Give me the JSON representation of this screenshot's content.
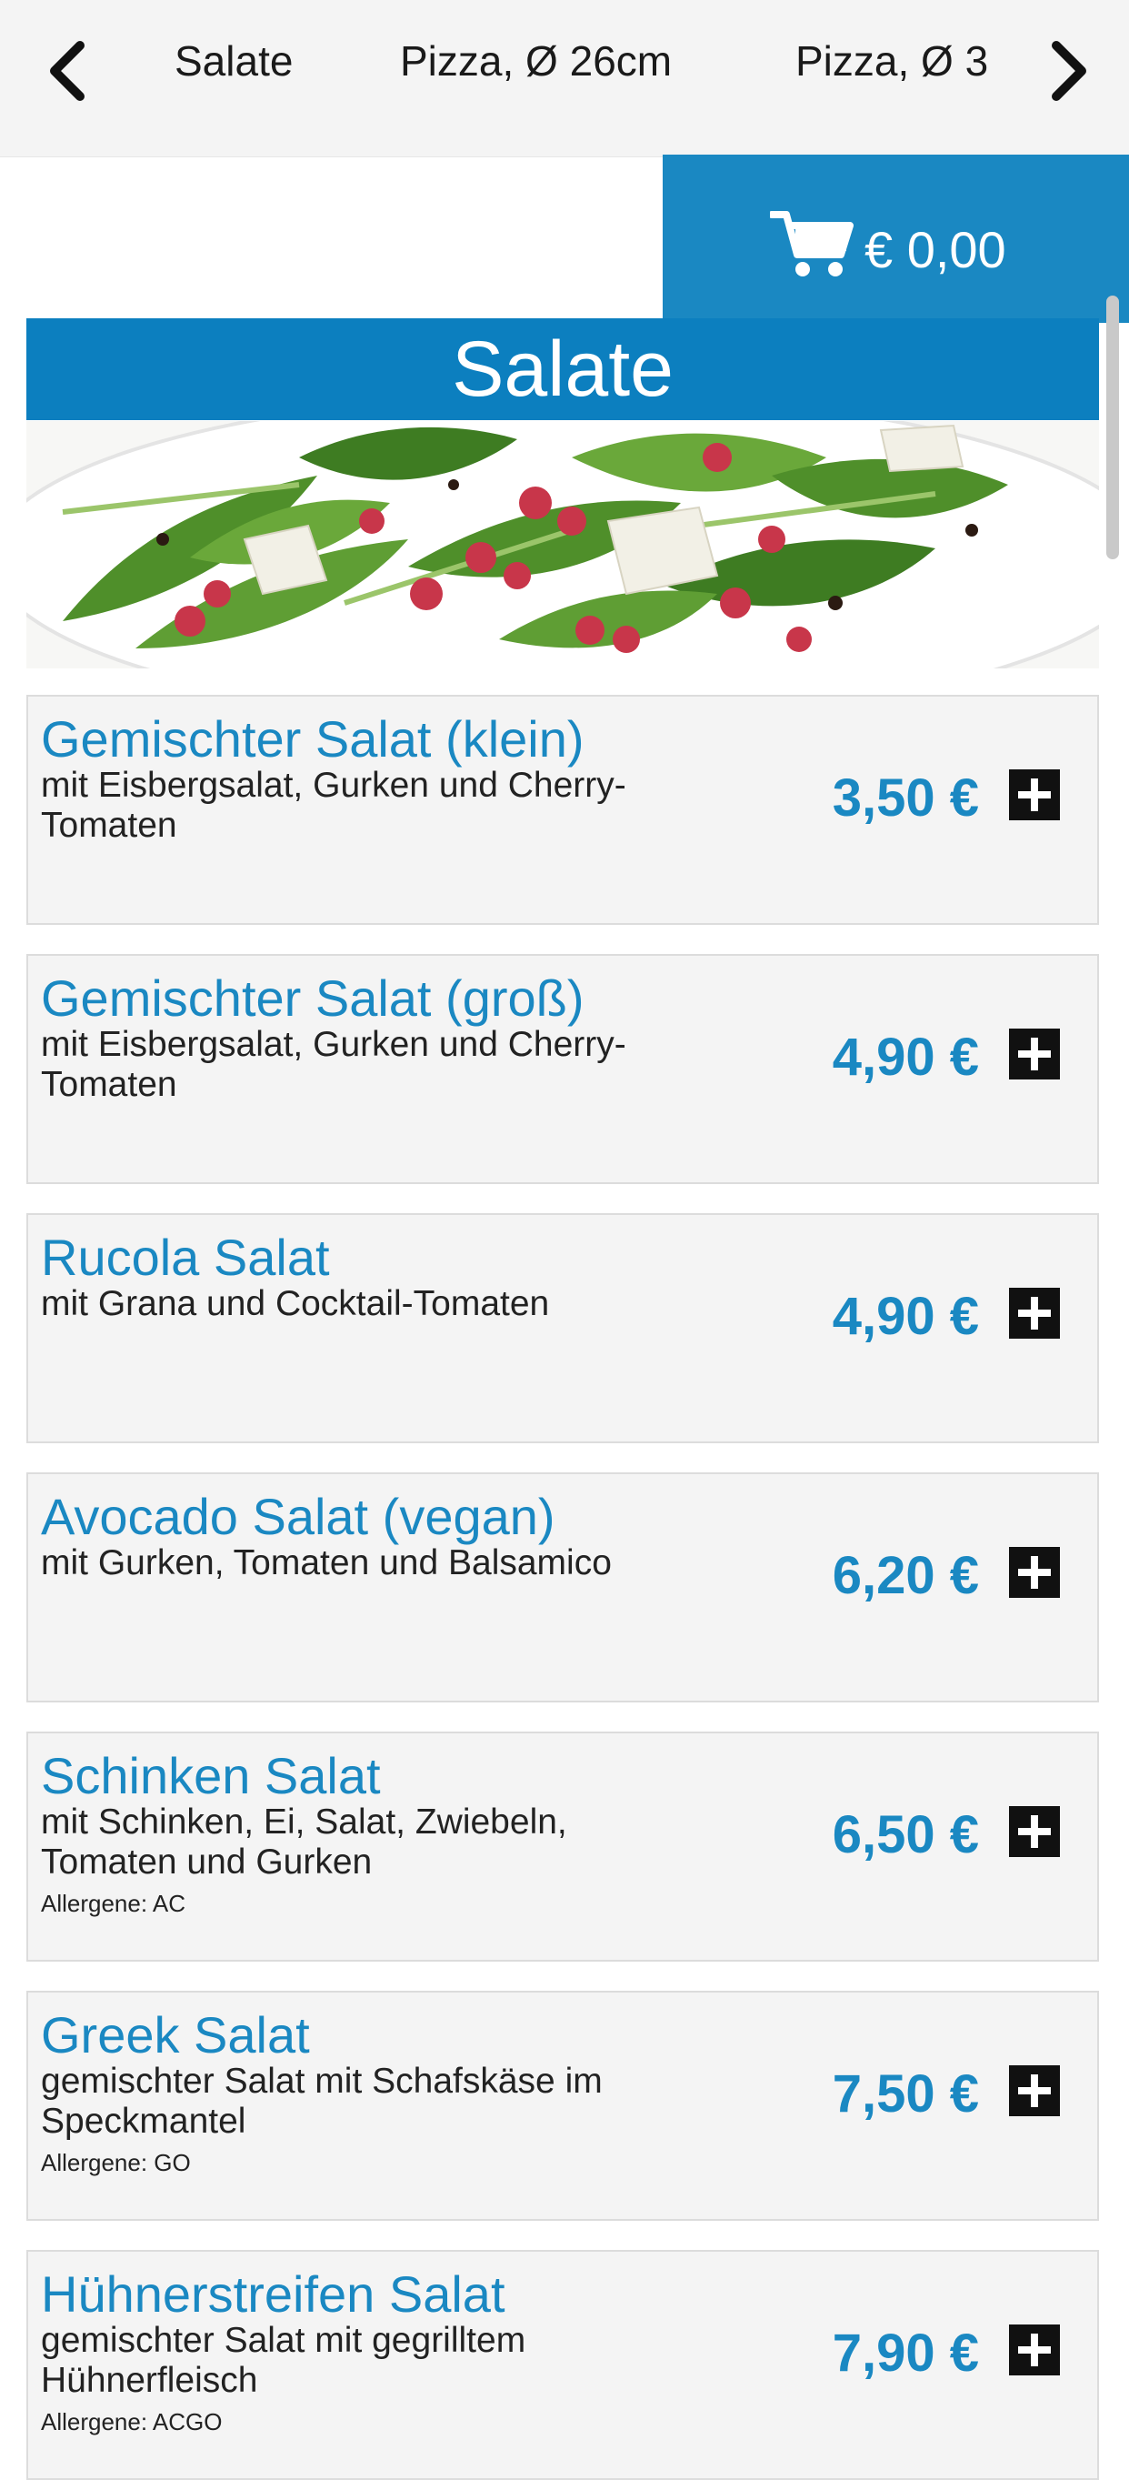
{
  "nav": {
    "categories": [
      "Salate",
      "Pizza, Ø 26cm",
      "Pizza, Ø 3"
    ],
    "prev_icon": "chevron-left-icon",
    "next_icon": "chevron-right-icon"
  },
  "cart": {
    "icon": "cart-icon",
    "total": "€ 0,00"
  },
  "section": {
    "title": "Salate",
    "image": "salad-photo"
  },
  "items": [
    {
      "name": "Gemischter Salat (klein)",
      "desc": "mit Eisbergsalat, Gurken und Cherry-Tomaten",
      "allergen": "",
      "price": "3,50 €"
    },
    {
      "name": "Gemischter Salat (groß)",
      "desc": "mit Eisbergsalat, Gurken und Cherry-Tomaten",
      "allergen": "",
      "price": "4,90 €"
    },
    {
      "name": "Rucola Salat",
      "desc": "mit Grana und Cocktail-Tomaten",
      "allergen": "",
      "price": "4,90 €"
    },
    {
      "name": "Avocado Salat (vegan)",
      "desc": "mit Gurken, Tomaten und Balsamico",
      "allergen": "",
      "price": "6,20 €"
    },
    {
      "name": "Schinken Salat",
      "desc": "mit Schinken, Ei, Salat, Zwiebeln, Tomaten und Gurken",
      "allergen": "Allergene: AC",
      "price": "6,50 €"
    },
    {
      "name": "Greek Salat",
      "desc": "gemischter Salat mit Schafskäse im Speckmantel",
      "allergen": "Allergene: GO",
      "price": "7,50 €"
    },
    {
      "name": "Hühnerstreifen Salat",
      "desc": "gemischter Salat mit gegrilltem Hühnerfleisch",
      "allergen": "Allergene: ACGO",
      "price": "7,90 €"
    }
  ],
  "colors": {
    "accent": "#1a88c2",
    "header": "#0c7fbf",
    "card": "#f4f4f4"
  }
}
